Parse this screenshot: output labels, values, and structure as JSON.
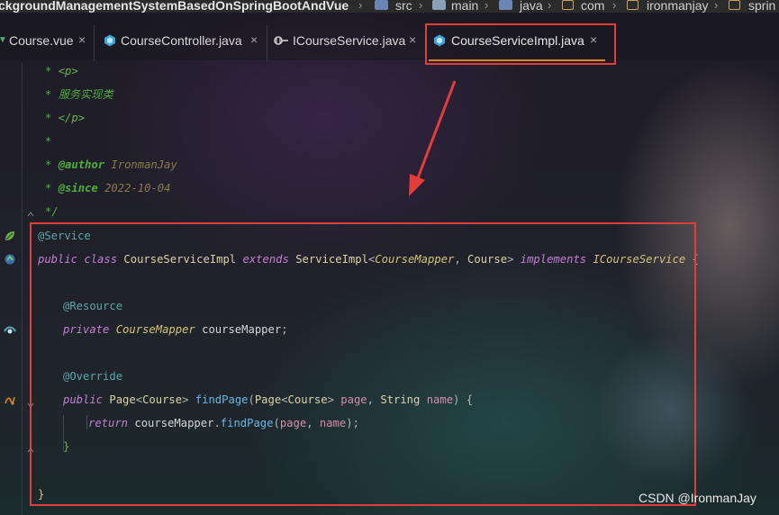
{
  "breadcrumb": {
    "project": "ckgroundManagementSystemBasedOnSpringBootAndVue",
    "items": [
      "src",
      "main",
      "java",
      "com",
      "ironmanjay",
      "sprin"
    ]
  },
  "tabs": [
    {
      "label": "Course.vue",
      "icon": "vue-icon",
      "active": false
    },
    {
      "label": "CourseController.java",
      "icon": "class-icon",
      "active": false
    },
    {
      "label": "ICourseService.java",
      "icon": "interface-icon",
      "active": false
    },
    {
      "label": "CourseServiceImpl.java",
      "icon": "class-icon",
      "active": true
    }
  ],
  "close_glyph": "×",
  "code": {
    "doc": {
      "p_open": "<p>",
      "desc": "服务实现类",
      "p_close": "</p>",
      "author_tag": "@author",
      "author": "IronmanJay",
      "since_tag": "@since",
      "since": "2022-10-04"
    },
    "annotation_service": "@Service",
    "kw_public": "public",
    "kw_class": "class",
    "class_name": "CourseServiceImpl",
    "kw_extends": "extends",
    "super_type": "ServiceImpl",
    "generic1": "CourseMapper",
    "generic2": "Course",
    "kw_implements": "implements",
    "iface": "ICourseService",
    "annotation_resource": "@Resource",
    "kw_private": "private",
    "field_type": "CourseMapper",
    "field_name": "courseMapper",
    "annotation_override": "@Override",
    "return_type": "Page",
    "return_generic": "Course",
    "method_name": "findPage",
    "param_type1": "Page",
    "param_generic1": "Course",
    "param_name1": "page",
    "param_type2": "String",
    "param_name2": "name",
    "kw_return": "return",
    "call_target": "courseMapper",
    "call_method": "findPage"
  },
  "watermark": "CSDN @IronmanJay",
  "colors": {
    "highlight_box": "#e23d3a",
    "active_tab_underline": "#d9822b",
    "comment": "#4fae3e",
    "keyword": "#c47fd5",
    "type": "#d6c27a",
    "annotation": "#5ea6ab",
    "function": "#6ab7e6",
    "parameter": "#d58ea8"
  }
}
